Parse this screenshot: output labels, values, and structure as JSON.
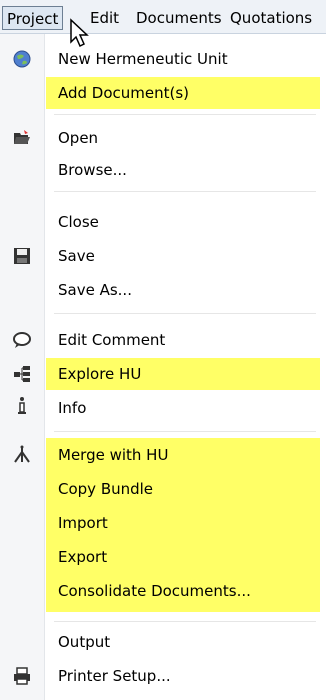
{
  "menubar": {
    "items": [
      "Project",
      "Edit",
      "Documents",
      "Quotations"
    ]
  },
  "menu": {
    "items": [
      {
        "label": "New Hermeneutic Unit",
        "highlight": false,
        "icon": "globe-icon"
      },
      {
        "label": "Add Document(s)",
        "highlight": true,
        "icon": ""
      },
      {
        "label": "Open",
        "highlight": false,
        "icon": "folder-open-icon"
      },
      {
        "label": "Browse...",
        "highlight": false,
        "icon": ""
      },
      {
        "label": "Close",
        "highlight": false,
        "icon": ""
      },
      {
        "label": "Save",
        "highlight": false,
        "icon": "floppy-disk-icon"
      },
      {
        "label": "Save As...",
        "highlight": false,
        "icon": ""
      },
      {
        "label": "Edit Comment",
        "highlight": false,
        "icon": "speech-bubble-icon"
      },
      {
        "label": "Explore HU",
        "highlight": true,
        "icon": "tree-explorer-icon"
      },
      {
        "label": "Info",
        "highlight": false,
        "icon": "info-icon"
      },
      {
        "label": "Merge with HU",
        "highlight": true,
        "icon": "merge-icon"
      },
      {
        "label": "Copy Bundle",
        "highlight": true,
        "icon": ""
      },
      {
        "label": "Import",
        "highlight": true,
        "icon": ""
      },
      {
        "label": "Export",
        "highlight": true,
        "icon": ""
      },
      {
        "label": "Consolidate Documents...",
        "highlight": true,
        "icon": ""
      },
      {
        "label": "Output",
        "highlight": false,
        "icon": ""
      },
      {
        "label": "Printer Setup...",
        "highlight": false,
        "icon": "printer-icon"
      }
    ]
  },
  "colors": {
    "highlight": "#ffff66",
    "menubar_bg": "#eef2f7",
    "active_border": "#6d7f93"
  }
}
